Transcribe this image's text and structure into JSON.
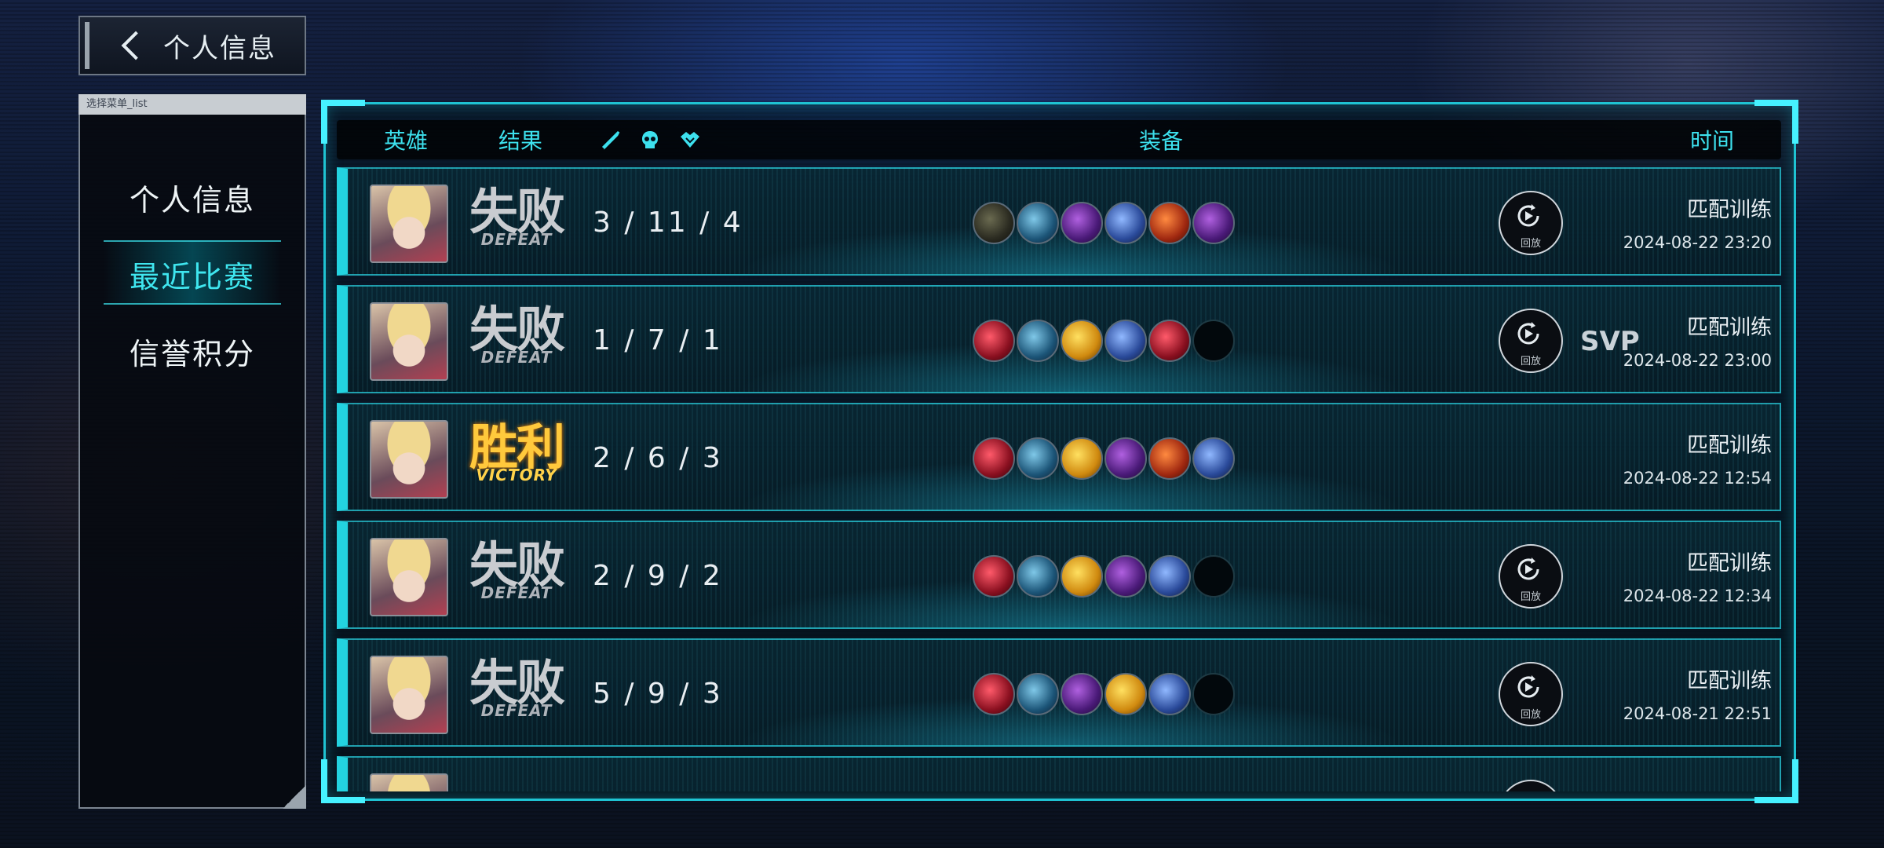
{
  "back_button": {
    "label": "个人信息"
  },
  "sidebar": {
    "tag": "选择菜单_list",
    "items": [
      {
        "label": "个人信息",
        "active": false
      },
      {
        "label": "最近比赛",
        "active": true
      },
      {
        "label": "信誉积分",
        "active": false
      }
    ]
  },
  "table": {
    "headers": {
      "hero": "英雄",
      "result": "结果",
      "equipment": "装备",
      "time": "时间"
    },
    "header_icons": [
      "sword-icon",
      "skull-icon",
      "handshake-icon"
    ],
    "replay_label": "回放",
    "rows": [
      {
        "result_cn": "失败",
        "result_en": "DEFEAT",
        "win": false,
        "kda": "3 / 11 / 4",
        "items": [
          "dark",
          "boot",
          "purple",
          "blue",
          "fire",
          "purple"
        ],
        "replay": true,
        "svp": "",
        "mode": "匹配训练",
        "datetime": "2024-08-22 23:20"
      },
      {
        "result_cn": "失败",
        "result_en": "DEFEAT",
        "win": false,
        "kda": "1 / 7 / 1",
        "items": [
          "red",
          "boot",
          "gold",
          "blue",
          "red",
          "empty"
        ],
        "replay": true,
        "svp": "SVP",
        "mode": "匹配训练",
        "datetime": "2024-08-22 23:00"
      },
      {
        "result_cn": "胜利",
        "result_en": "VICTORY",
        "win": true,
        "kda": "2 / 6 / 3",
        "items": [
          "red",
          "boot",
          "gold",
          "purple",
          "fire",
          "blue"
        ],
        "replay": false,
        "svp": "",
        "mode": "匹配训练",
        "datetime": "2024-08-22 12:54"
      },
      {
        "result_cn": "失败",
        "result_en": "DEFEAT",
        "win": false,
        "kda": "2 / 9 / 2",
        "items": [
          "red",
          "boot",
          "gold",
          "purple",
          "blue",
          "empty"
        ],
        "replay": true,
        "svp": "",
        "mode": "匹配训练",
        "datetime": "2024-08-22 12:34"
      },
      {
        "result_cn": "失败",
        "result_en": "DEFEAT",
        "win": false,
        "kda": "5 / 9 / 3",
        "items": [
          "red",
          "boot",
          "purple",
          "gold",
          "blue",
          "empty"
        ],
        "replay": true,
        "svp": "",
        "mode": "匹配训练",
        "datetime": "2024-08-21 22:51"
      },
      {
        "result_cn": "",
        "result_en": "",
        "win": false,
        "kda": "",
        "items": [],
        "replay": true,
        "svp": "",
        "mode": "",
        "datetime": ""
      }
    ]
  },
  "colors": {
    "accent": "#23d3e0",
    "victory": "#ffc93c",
    "defeat": "#c9ccd0"
  }
}
